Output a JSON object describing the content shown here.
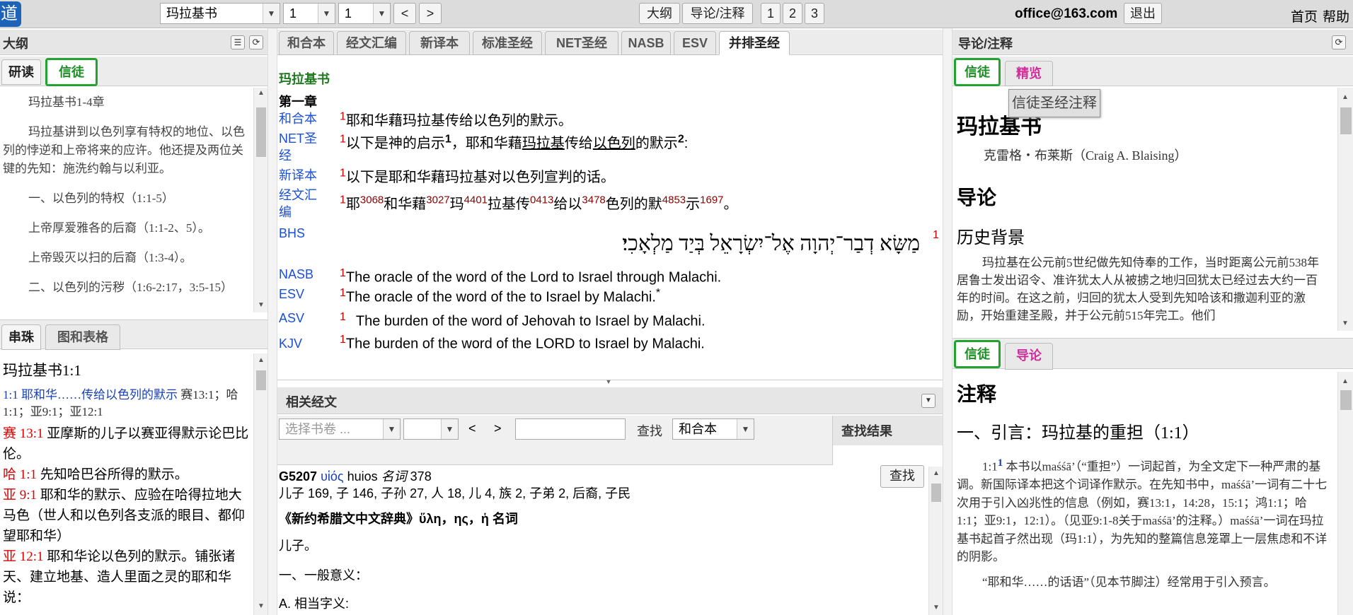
{
  "topbar": {
    "logo": "道",
    "book_select": "玛拉基书",
    "chapter_select": "1",
    "verse_select": "1",
    "prev": "<",
    "next": ">",
    "outline_btn": "大纲",
    "intro_btn": "导论/注释",
    "layout1": "1",
    "layout2": "2",
    "layout3": "3",
    "email": "office@163.com",
    "logout": "退出",
    "home": "首页",
    "help": "帮助"
  },
  "outline": {
    "title": "大纲",
    "tab_study": "研读",
    "tab_xintu": "信徒",
    "lines": [
      "玛拉基书1-4章",
      "玛拉基讲到以色列享有特权的地位、以色列的悖逆和上帝将来的应许。他还提及两位关键的先知：施洗约翰与以利亚。",
      "一、以色列的特权（1:1-5）",
      "上帝厚爱雅各的后裔（1:1-2、5）。",
      "上帝毁灭以扫的后裔（1:3-4）。",
      "二、以色列的污秽（1:6-2:17，3:5-15）"
    ]
  },
  "crossref": {
    "tab_chain": "串珠",
    "tab_maps": "图和表格",
    "heading": "玛拉基书1:1",
    "line1_ref": "1:1",
    "line1_text": "耶和华……传给以色列的默示",
    "line1_refs": "赛13:1；哈1:1；亚9:1；亚12:1",
    "items": [
      {
        "ref": "赛 13:1",
        "text": "亚摩斯的儿子以赛亚得默示论巴比伦。"
      },
      {
        "ref": "哈 1:1",
        "text": "先知哈巴谷所得的默示。"
      },
      {
        "ref": "亚 9:1",
        "text": "耶和华的默示、应验在哈得拉地大马色（世人和以色列各支派的眼目、都仰望耶和华）"
      },
      {
        "ref": "亚 12:1",
        "text": "耶和华论以色列的默示。铺张诸天、建立地基、造人里面之灵的耶和华说："
      }
    ]
  },
  "bible_tabs": [
    "和合本",
    "经文汇编",
    "新译本",
    "标准圣经",
    "NET圣经",
    "NASB",
    "ESV",
    "并排圣经"
  ],
  "bible": {
    "book": "玛拉基书",
    "chapter": "第一章",
    "rows": [
      {
        "label": "和合本",
        "num": "1",
        "text": "耶和华藉玛拉基传给以色列的默示。"
      },
      {
        "label": "NET圣经",
        "num": "1",
        "text": "以下是神的启示",
        "text_sup1": "1",
        "text2": "，耶和华藉",
        "text_u1": "玛拉基",
        "text3": "传给",
        "text_u2": "以色列",
        "text4": "的默示",
        "text_sup2": "2",
        "text5": ":"
      },
      {
        "label": "新译本",
        "num": "1",
        "text": "以下是耶和华藉玛拉基对以色列宣判的话。"
      },
      {
        "label": "经文汇编",
        "num": "1",
        "segments": [
          {
            "t": "耶",
            "s": "3068"
          },
          {
            "t": "和华藉",
            "s": "3027"
          },
          {
            "t": "玛",
            "s": "4401"
          },
          {
            "t": "拉基传",
            "s": "0413"
          },
          {
            "t": "给以",
            "s": "3478"
          },
          {
            "t": "色列的默",
            "s": "4853"
          },
          {
            "t": "示",
            "s": "1697"
          },
          {
            "t": "。",
            "s": ""
          }
        ]
      },
      {
        "label": "BHS",
        "num": "1",
        "text": "מַשָּׂא דְבַר־יְהוָה אֶל־יִשְׂרָאֵל בְּיַד מַלְאָכִי׃"
      },
      {
        "label": "NASB",
        "num": "1",
        "text": "The oracle of the word of the Lord to Israel through Malachi."
      },
      {
        "label": "ESV",
        "num": "1",
        "text": "The oracle of the word of the to Israel by Malachi.",
        "mark": "*"
      },
      {
        "label": "ASV",
        "num": "1",
        "text": "The burden of the word of Jehovah to Israel by Malachi."
      },
      {
        "label": "KJV",
        "num": "1",
        "text": "The burden of the word of the LORD to Israel by Malachi."
      }
    ]
  },
  "related": {
    "title": "相关经文",
    "book_placeholder": "选择书卷 ...",
    "prev": "<",
    "next": ">",
    "find_label": "查找",
    "version": "和合本",
    "results_title": "查找结果"
  },
  "lexicon": {
    "strong": "G5207",
    "greek": "υἱός",
    "translit": "huios",
    "pos": "名词",
    "count": "378",
    "glosses": "儿子 169, 子 146, 子孙 27, 人 18, 儿 4, 族 2, 子弟 2, 后裔, 子民",
    "dict_title": "《新约希腊文中文辞典》ὕλη，ης，ἡ 名词",
    "meaning": "儿子。",
    "sec1": "一、一般意义：",
    "sec1a": "A. 相当字义:",
    "search_btn": "查找"
  },
  "intro": {
    "title": "导论/注释",
    "tab_xintu": "信徒",
    "tab_jinglan": "精览",
    "tooltip": "信徒圣经注释",
    "book": "玛拉基书",
    "author": "克雷格・布莱斯（Craig A. Blaising）",
    "h_intro": "导论",
    "h_bg": "历史背景",
    "para": "玛拉基在公元前5世纪做先知侍奉的工作，当时距离公元前538年居鲁士发出诏令、准许犹太人从被掳之地归回犹太已经过去大约一百年的时间。在这之前，归回的犹太人受到先知哈该和撒迦利亚的激励，开始重建圣殿，并于公元前515年完工。他们"
  },
  "notes": {
    "tab_xintu": "信徒",
    "tab_intro": "导论",
    "title": "注释",
    "h1": "一、引言：玛拉基的重担（1:1）",
    "ref": "1:1",
    "ref_sup": "1",
    "para1": "本书以maśśā’（“重担”）一词起首，为全文定下一种严肃的基调。新国际译本把这个词译作默示。在先知书中，maśśā’一词有二十七次用于引入凶兆性的信息（例如，赛13:1，14:28，15:1；鸿1:1；哈1:1；亚9:1，12:1）。（见亚9:1-8关于maśśā’的注释。）maśśā’一词在玛拉基书起首孑然出现（玛1:1），为先知的整篇信息笼罩上一层焦虑和不详的阴影。",
    "para2": "“耶和华……的话语”（见本节脚注）经常用于引入预言。"
  }
}
